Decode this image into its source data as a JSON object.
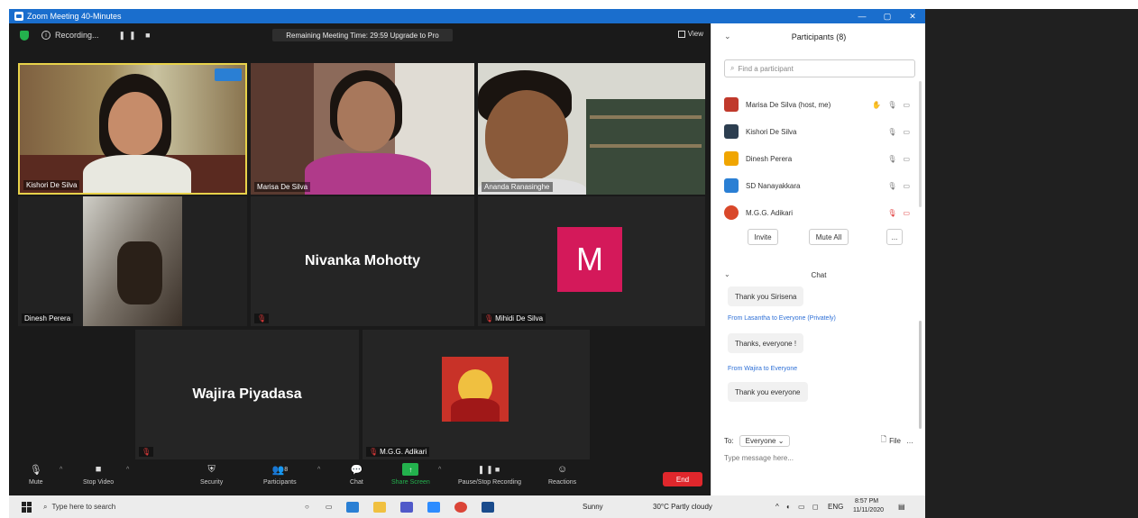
{
  "window": {
    "title": "Zoom Meeting 40-Minutes",
    "controls": [
      "—",
      "▢",
      "✕"
    ]
  },
  "topbar": {
    "recording_label": "Recording...",
    "pause_stop": "❚❚ ■",
    "meeting_name": "Remaining Meeting Time: 29:59 Upgrade to Pro",
    "view_label": "View"
  },
  "tiles": [
    {
      "name": "Kishori De Silva",
      "type": "video"
    },
    {
      "name": "Marisa De Silva",
      "type": "video"
    },
    {
      "name": "Ananda Ranasinghe",
      "type": "video"
    },
    {
      "name": "Dinesh Perera",
      "type": "video"
    },
    {
      "name": "Nivanka Mohotty",
      "type": "name"
    },
    {
      "name": "Mihidi De Silva",
      "type": "avatar",
      "initial": "M"
    },
    {
      "name": "Wajira Piyadasa",
      "type": "name"
    },
    {
      "name": "M.G.G. Adikari",
      "type": "picture"
    }
  ],
  "toolbar": {
    "mute": "Mute",
    "video": "Stop Video",
    "security": "Security",
    "participants": "Participants",
    "participants_count": "8",
    "chat": "Chat",
    "share": "Share Screen",
    "record": "Pause/Stop Recording",
    "reactions": "Reactions",
    "end": "End"
  },
  "panel": {
    "title": "Participants (8)",
    "search_placeholder": "Find a participant",
    "participants": [
      {
        "name": "Marisa De Silva (host, me)",
        "color": "#c0392b"
      },
      {
        "name": "Kishori De Silva",
        "color": "#2c3e50"
      },
      {
        "name": "Dinesh Perera",
        "color": "#f0a500"
      },
      {
        "name": "SD Nanayakkara",
        "color": "#2a7fd4"
      },
      {
        "name": "M.G.G. Adikari",
        "color": "#d9482a"
      }
    ],
    "invite": "Invite",
    "mute_all": "Mute All",
    "more": "...",
    "chat_title": "Chat",
    "messages": [
      {
        "from": "",
        "text": "Thank you Sirisena"
      },
      {
        "from": "From Lasantha to Everyone (Privately)",
        "text": "Thanks, everyone !"
      },
      {
        "from": "From Wajira to Everyone",
        "text": "Thank you everyone"
      }
    ],
    "to_label": "To:",
    "to_value": "Everyone ⌄",
    "file_label": "File",
    "chat_placeholder": "Type message here..."
  },
  "taskbar": {
    "search_placeholder": "Type here to search",
    "weather": "Sunny",
    "temp": "30°C Partly cloudy",
    "lang": "ENG",
    "time": "8:57 PM",
    "date": "11/11/2020"
  }
}
